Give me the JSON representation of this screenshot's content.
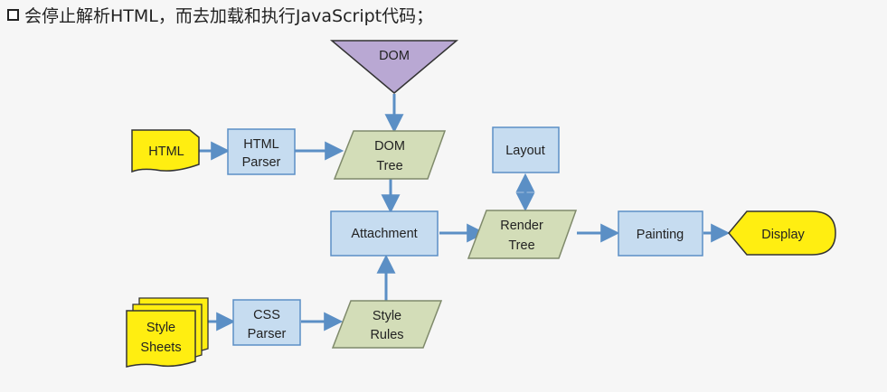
{
  "caption": "会停止解析HTML，而去加载和执行JavaScript代码；",
  "colors": {
    "box_blue": "#c6dcf0",
    "box_blue_stroke": "#5b8fc5",
    "parallelogram_green": "#d3ddb8",
    "parallelogram_stroke": "#7f8a6b",
    "doc_yellow": "#ffee11",
    "dom_triangle": "#b9a8d3",
    "arrow": "#5b8fc5"
  },
  "nodes": {
    "dom_source": "DOM",
    "html_doc": "HTML",
    "html_parser": [
      "HTML",
      "Parser"
    ],
    "dom_tree": [
      "DOM",
      "Tree"
    ],
    "layout": "Layout",
    "attachment": "Attachment",
    "render_tree": [
      "Render",
      "Tree"
    ],
    "painting": "Painting",
    "display": "Display",
    "style_sheets": [
      "Style",
      "Sheets"
    ],
    "css_parser": [
      "CSS",
      "Parser"
    ],
    "style_rules": [
      "Style",
      "Rules"
    ]
  }
}
